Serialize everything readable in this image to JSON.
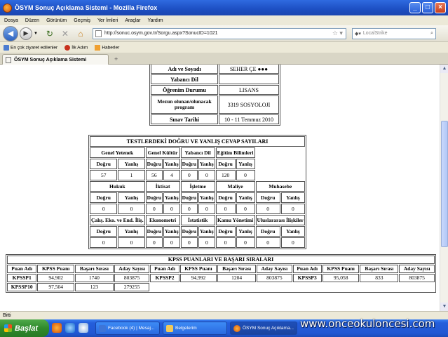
{
  "window": {
    "title": "ÖSYM Sonuç Açıklama Sistemi - Mozilla Firefox",
    "controls": [
      "_",
      "□",
      "×"
    ]
  },
  "menu": [
    "Dosya",
    "Düzen",
    "Görünüm",
    "Geçmiş",
    "Yer İmleri",
    "Araçlar",
    "Yardım"
  ],
  "nav": {
    "url": "http://sonuc.osym.gov.tr/Sorgu.aspx?SonucID=1021",
    "search_placeholder": "LocalStrike"
  },
  "bookmarks": [
    "En çok ziyaret edilenler",
    "İlk Adım",
    "Haberler"
  ],
  "tab": {
    "label": "ÖSYM Sonuç Açıklama Sistemi",
    "new_tab": "+"
  },
  "personal": {
    "rows": [
      {
        "label": "Adı ve Soyadı",
        "value": "SEHER ÇE ●●●"
      },
      {
        "label": "Yabancı Dil",
        "value": ""
      },
      {
        "label": "Öğrenim Durumu",
        "value": "LISANS"
      },
      {
        "label": "Mezun olunan/olunacak program",
        "value": "3319 SOSYOLOJI"
      },
      {
        "label": "Sınav Tarihi",
        "value": "10 - 11 Temmuz 2010"
      }
    ]
  },
  "tests": {
    "title": "TESTLERDEKİ DOĞRU VE YANLIŞ CEVAP SAYILARI",
    "dogru": "Doğru",
    "yanlis": "Yanlış",
    "groups": [
      [
        {
          "name": "Genel Yetenek",
          "d": "57",
          "y": "1"
        },
        {
          "name": "Genel Kültür",
          "d": "56",
          "y": "4"
        },
        {
          "name": "Yabancı Dil",
          "d": "0",
          "y": "0"
        },
        {
          "name": "Eğitim Bilimleri",
          "d": "120",
          "y": "0"
        }
      ],
      [
        {
          "name": "Hukuk",
          "d": "0",
          "y": "0"
        },
        {
          "name": "İktisat",
          "d": "0",
          "y": "0"
        },
        {
          "name": "İşletme",
          "d": "0",
          "y": "0"
        },
        {
          "name": "Maliye",
          "d": "0",
          "y": "0"
        },
        {
          "name": "Muhasebe",
          "d": "0",
          "y": "0"
        }
      ],
      [
        {
          "name": "Çalış. Eko. ve End. İliş.",
          "d": "0",
          "y": "0"
        },
        {
          "name": "Ekonometri",
          "d": "0",
          "y": "0"
        },
        {
          "name": "İstatistik",
          "d": "0",
          "y": "0"
        },
        {
          "name": "Kamu Yönetimi",
          "d": "0",
          "y": "0"
        },
        {
          "name": "Uluslararası İlişkiler",
          "d": "0",
          "y": "0"
        }
      ]
    ]
  },
  "scores": {
    "title": "KPSS PUANLARI VE BAŞARI SIRALARI",
    "headers": [
      "Puan Adı",
      "KPSS Puanı",
      "Başarı Sırası",
      "Aday Sayısı",
      "Puan Adı",
      "KPSS Puanı",
      "Başarı Sırası",
      "Aday Sayısı",
      "Puan Adı",
      "KPSS Puanı",
      "Başarı Sırası",
      "Aday Sayısı"
    ],
    "rows": [
      [
        "KPSSP1",
        "94,902",
        "1740",
        "803875",
        "KPSSP2",
        "94,992",
        "1204",
        "803875",
        "KPSSP3",
        "95,058",
        "833",
        "803875"
      ],
      [
        "KPSSP10",
        "97,504",
        "123",
        "279255"
      ]
    ]
  },
  "status": {
    "text": "Bitti"
  },
  "taskbar": {
    "start": "Başlat",
    "items": [
      "Facebook (4) | Mesaj...",
      "Belgelerim",
      "ÖSYM Sonuç Açıklama..."
    ]
  },
  "watermark": "www.onceokuloncesi.com"
}
